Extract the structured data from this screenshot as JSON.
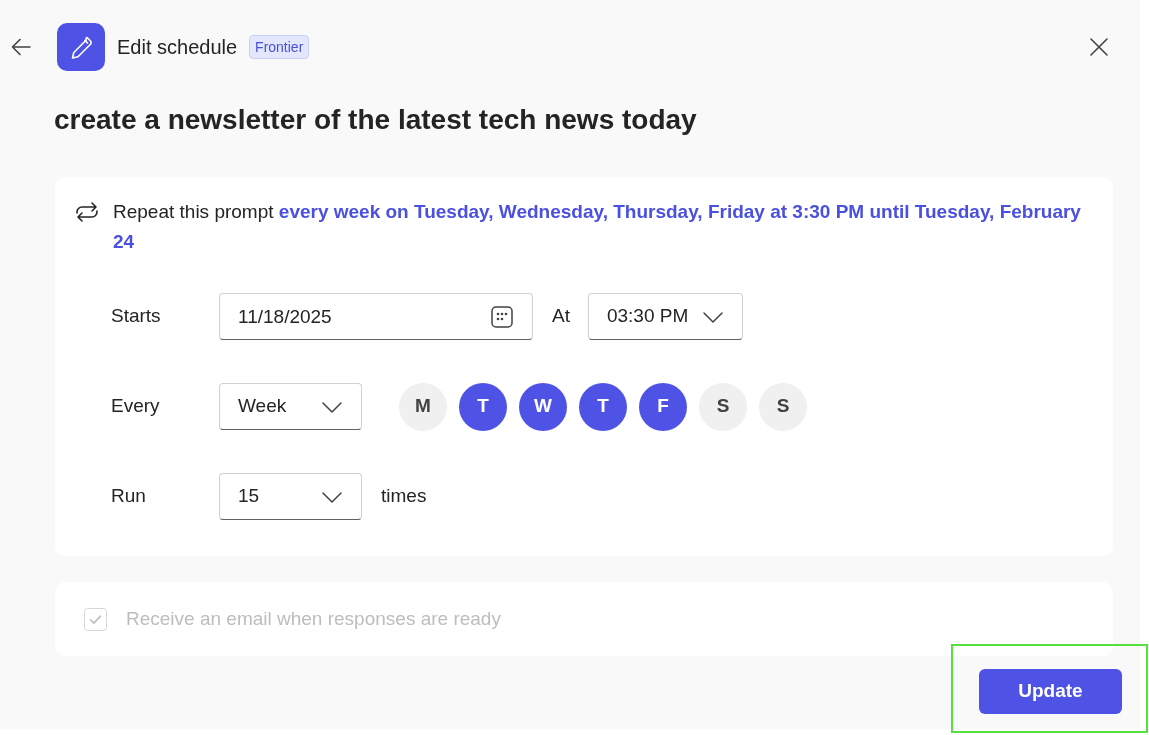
{
  "header": {
    "title": "Edit schedule",
    "badge": "Frontier"
  },
  "prompt": "create a newsletter of the latest tech news today",
  "schedule": {
    "summary": "Repeat this prompt **every week on Tuesday, Wednesday, Thursday, Friday at 3:30 PM until Tuesday, February 24**",
    "starts": {
      "label": "Starts",
      "value": "11/18/2025"
    },
    "at": {
      "label": "At",
      "value": "03:30 PM"
    },
    "every": {
      "label": "Every",
      "value": "Week"
    },
    "days": [
      {
        "label": "M",
        "selected": false
      },
      {
        "label": "T",
        "selected": true
      },
      {
        "label": "W",
        "selected": true
      },
      {
        "label": "T",
        "selected": true
      },
      {
        "label": "F",
        "selected": true
      },
      {
        "label": "S",
        "selected": false
      },
      {
        "label": "S",
        "selected": false
      }
    ],
    "run": {
      "label": "Run",
      "value": "15",
      "suffix": "times"
    }
  },
  "email_option": {
    "label": "Receive an email when responses are ready",
    "checked": true,
    "disabled": true
  },
  "actions": [
    {
      "label": "Update"
    }
  ]
}
